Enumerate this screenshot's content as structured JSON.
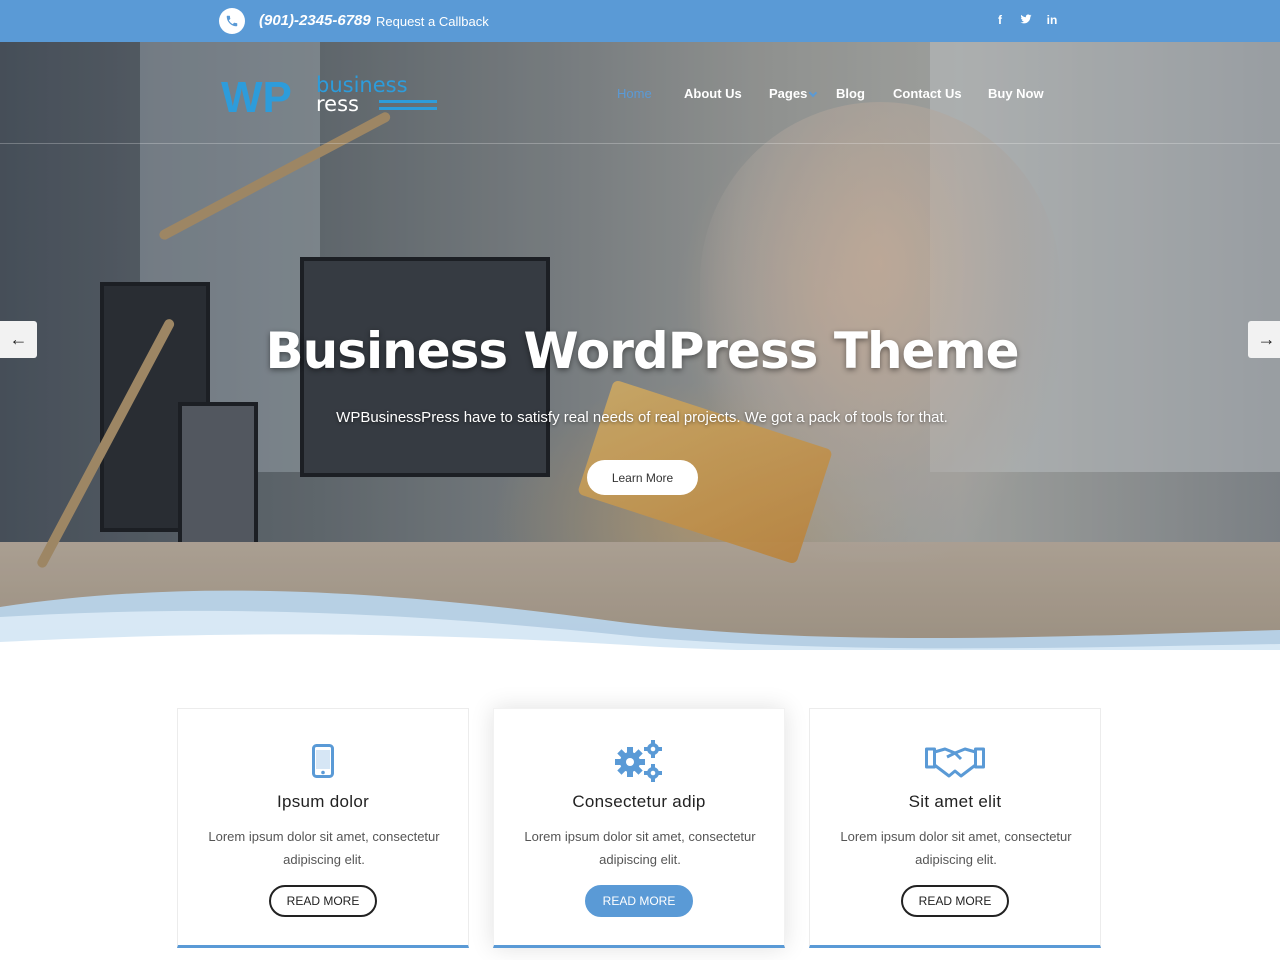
{
  "topbar": {
    "phone": "(901)-2345-6789",
    "callback": "Request a Callback",
    "social_icons": [
      "facebook-icon",
      "twitter-icon",
      "linkedin-icon"
    ],
    "social_glyphs": [
      "f",
      "t",
      "in"
    ]
  },
  "logo": {
    "wp": "WP",
    "business": "business",
    "ress": "ress"
  },
  "nav": {
    "items": [
      {
        "label": "Home"
      },
      {
        "label": "About Us"
      },
      {
        "label": "Pages"
      },
      {
        "label": "Blog"
      },
      {
        "label": "Contact Us"
      },
      {
        "label": "Buy Now"
      }
    ]
  },
  "hero": {
    "title": "Business WordPress Theme",
    "subtitle": "WPBusinessPress have to satisfy real needs of real projects. We got a pack of tools for that.",
    "button": "Learn More",
    "prev_glyph": "←",
    "next_glyph": "→"
  },
  "cards": [
    {
      "icon": "mobile-phone-icon",
      "title": "Ipsum dolor",
      "text": "Lorem ipsum dolor sit amet, consectetur adipiscing elit.",
      "button": "READ MORE"
    },
    {
      "icon": "gears-icon",
      "title": "Consectetur adip",
      "text": "Lorem ipsum dolor sit amet, consectetur adipiscing elit.",
      "button": "READ MORE"
    },
    {
      "icon": "handshake-icon",
      "title": "Sit amet elit",
      "text": "Lorem ipsum dolor sit amet, consectetur adipiscing elit.",
      "button": "READ MORE"
    }
  ],
  "colors": {
    "accent": "#5a9ad6",
    "white": "#ffffff",
    "dark": "#222222"
  }
}
